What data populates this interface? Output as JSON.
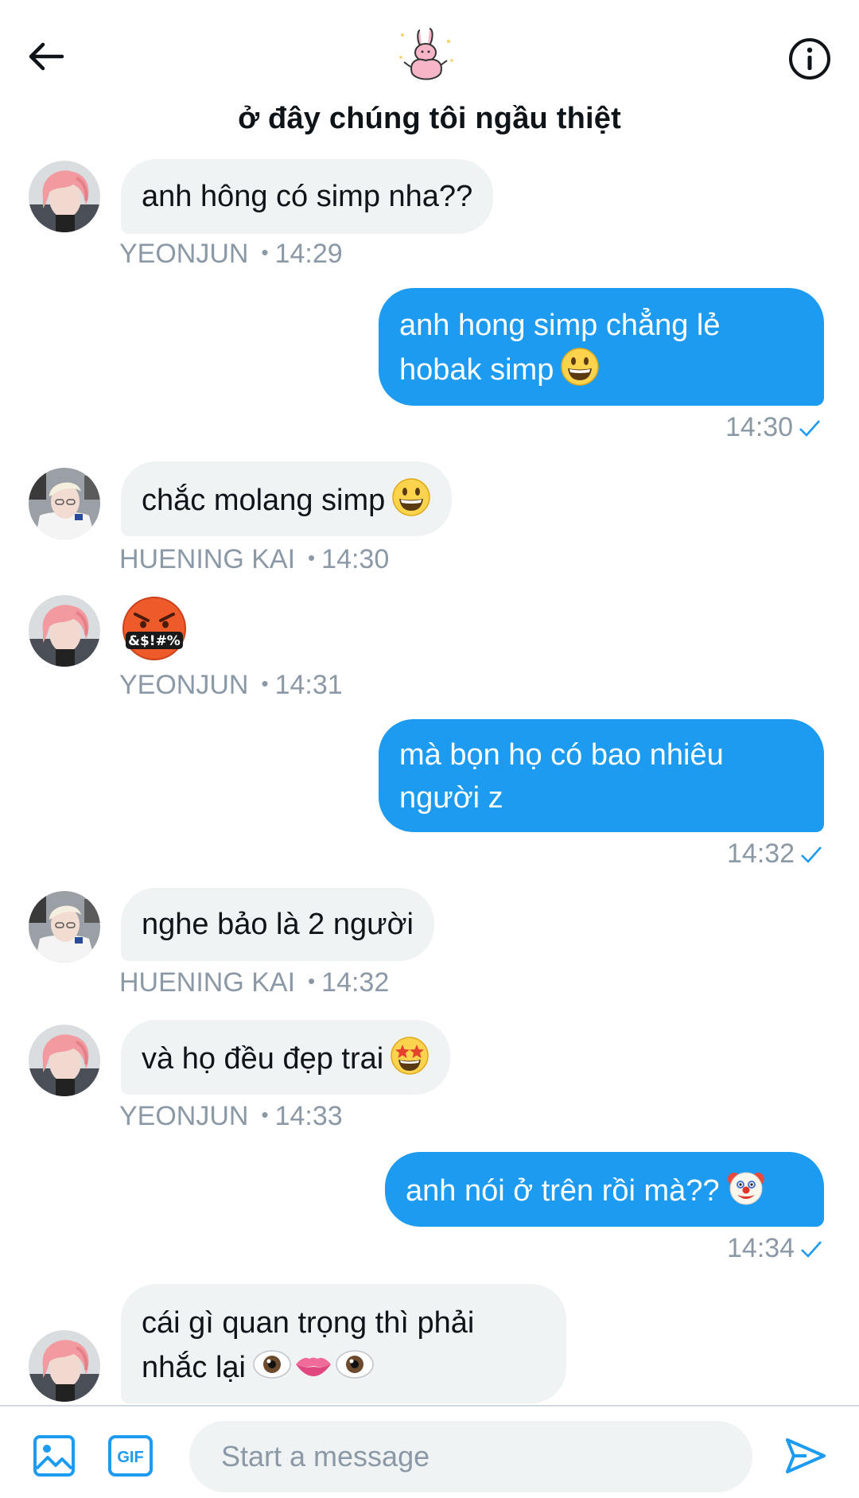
{
  "conversation": {
    "title": "ở đây chúng tôi ngầu thiệt"
  },
  "messages": [
    {
      "sender": "YEONJUN",
      "text": "anh hông có simp nha??",
      "time": "14:29"
    },
    {
      "sender": "me",
      "line1": "anh hong simp chẳng lẻ",
      "line2": "hobak simp",
      "emoji": "grinning-face",
      "time": "14:30",
      "status": "sent-check"
    },
    {
      "sender": "HUENING KAI",
      "text": "chắc molang simp",
      "emoji": "grinning-face",
      "time": "14:30"
    },
    {
      "sender": "YEONJUN",
      "emoji": "face-with-symbols-on-mouth",
      "emoji_text": "&$!#%",
      "time": "14:31"
    },
    {
      "sender": "me",
      "line1": "mà bọn họ có bao nhiêu",
      "line2": "người z",
      "time": "14:32",
      "status": "sent-check"
    },
    {
      "sender": "HUENING KAI",
      "text": "nghe bảo là 2 người",
      "time": "14:32"
    },
    {
      "sender": "YEONJUN",
      "text": "và họ đều đẹp trai",
      "emoji": "star-struck",
      "time": "14:33"
    },
    {
      "sender": "me",
      "text": "anh nói ở trên rồi mà??",
      "emoji": "clown-face",
      "time": "14:34",
      "status": "sent-check"
    },
    {
      "sender": "YEONJUN",
      "line1": "cái gì quan trọng thì phải",
      "line2": "nhắc lại",
      "emoji": [
        "eye",
        "lips",
        "eye"
      ]
    }
  ],
  "composer": {
    "placeholder": "Start a message",
    "gif_label": "GIF"
  },
  "colors": {
    "accent": "#1d9bf0",
    "incoming_bubble": "#eff3f4",
    "meta_text": "#8b98a5"
  },
  "icons": [
    "back-arrow-icon",
    "info-icon",
    "image-icon",
    "gif-icon",
    "send-icon",
    "check-icon"
  ]
}
